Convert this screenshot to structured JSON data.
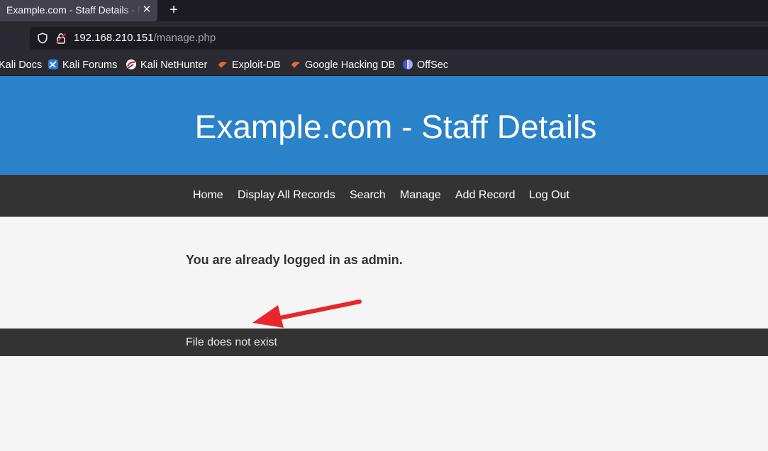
{
  "browser": {
    "tab_title": "Example.com - Staff Details - Mozilla Firefox",
    "tab_close": "✕",
    "new_tab": "+",
    "url_host": "192.168.210.151",
    "url_path": "/manage.php",
    "bookmarks": [
      {
        "label": "Kali Docs",
        "icon": "kali-docs-icon"
      },
      {
        "label": "Kali Forums",
        "icon": "kali-forums-icon"
      },
      {
        "label": "Kali NetHunter",
        "icon": "kali-nethunter-icon"
      },
      {
        "label": "Exploit-DB",
        "icon": "exploit-db-icon"
      },
      {
        "label": "Google Hacking DB",
        "icon": "google-hacking-db-icon"
      },
      {
        "label": "OffSec",
        "icon": "offsec-icon"
      }
    ]
  },
  "site": {
    "title": "Example.com - Staff Details",
    "nav": [
      "Home",
      "Display All Records",
      "Search",
      "Manage",
      "Add Record",
      "Log Out"
    ],
    "message": "You are already logged in as admin.",
    "footer_text": "File does not exist"
  },
  "colors": {
    "header_blue": "#2a82c9",
    "nav_dark": "#333333",
    "annotation_arrow": "#e8262b"
  }
}
